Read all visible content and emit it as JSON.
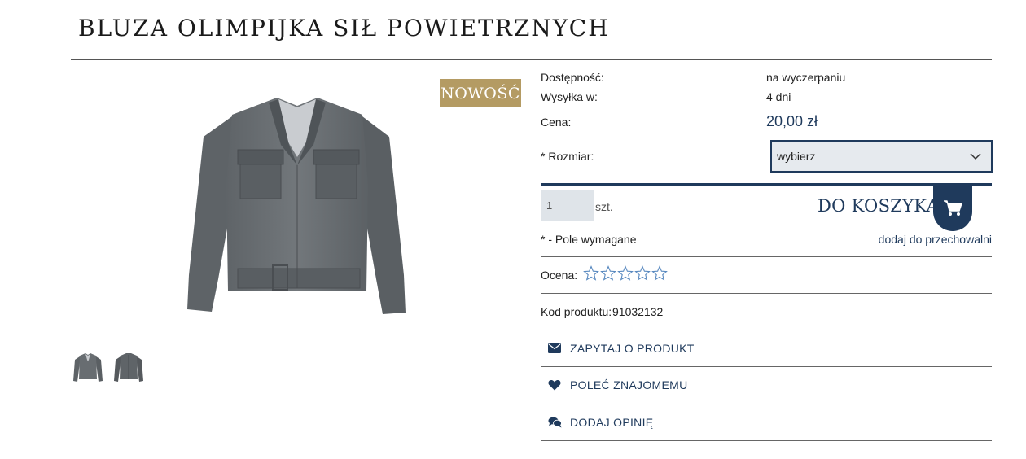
{
  "product": {
    "title": "BLUZA OLIMPIJKA SIŁ POWIETRZNYCH",
    "badge": "NOWOŚĆ"
  },
  "details": {
    "availability_label": "Dostępność:",
    "availability_value": "na wyczerpaniu",
    "shipping_label": "Wysyłka w:",
    "shipping_value": "4 dni",
    "price_label": "Cena:",
    "price_value": "20,00 zł",
    "size_label": "* Rozmiar:",
    "size_selected": "wybierz"
  },
  "cart": {
    "quantity": "1",
    "unit": "szt.",
    "add_label": "DO KOSZYKA",
    "required_note": "* - Pole wymagane",
    "store_link": "dodaj do przechowalni"
  },
  "rating": {
    "label": "Ocena:",
    "value": 0,
    "max": 5
  },
  "code": {
    "label": "Kod produktu:",
    "value": "91032132"
  },
  "actions": [
    {
      "label": "ZAPYTAJ O PRODUKT",
      "icon": "envelope-icon"
    },
    {
      "label": "POLEĆ ZNAJOMEMU",
      "icon": "heart-icon"
    },
    {
      "label": "DODAJ OPINIĘ",
      "icon": "comments-icon"
    }
  ],
  "colors": {
    "accent": "#1f3a5c",
    "badge": "#b49b63",
    "input_bg": "#dfe4e9"
  }
}
